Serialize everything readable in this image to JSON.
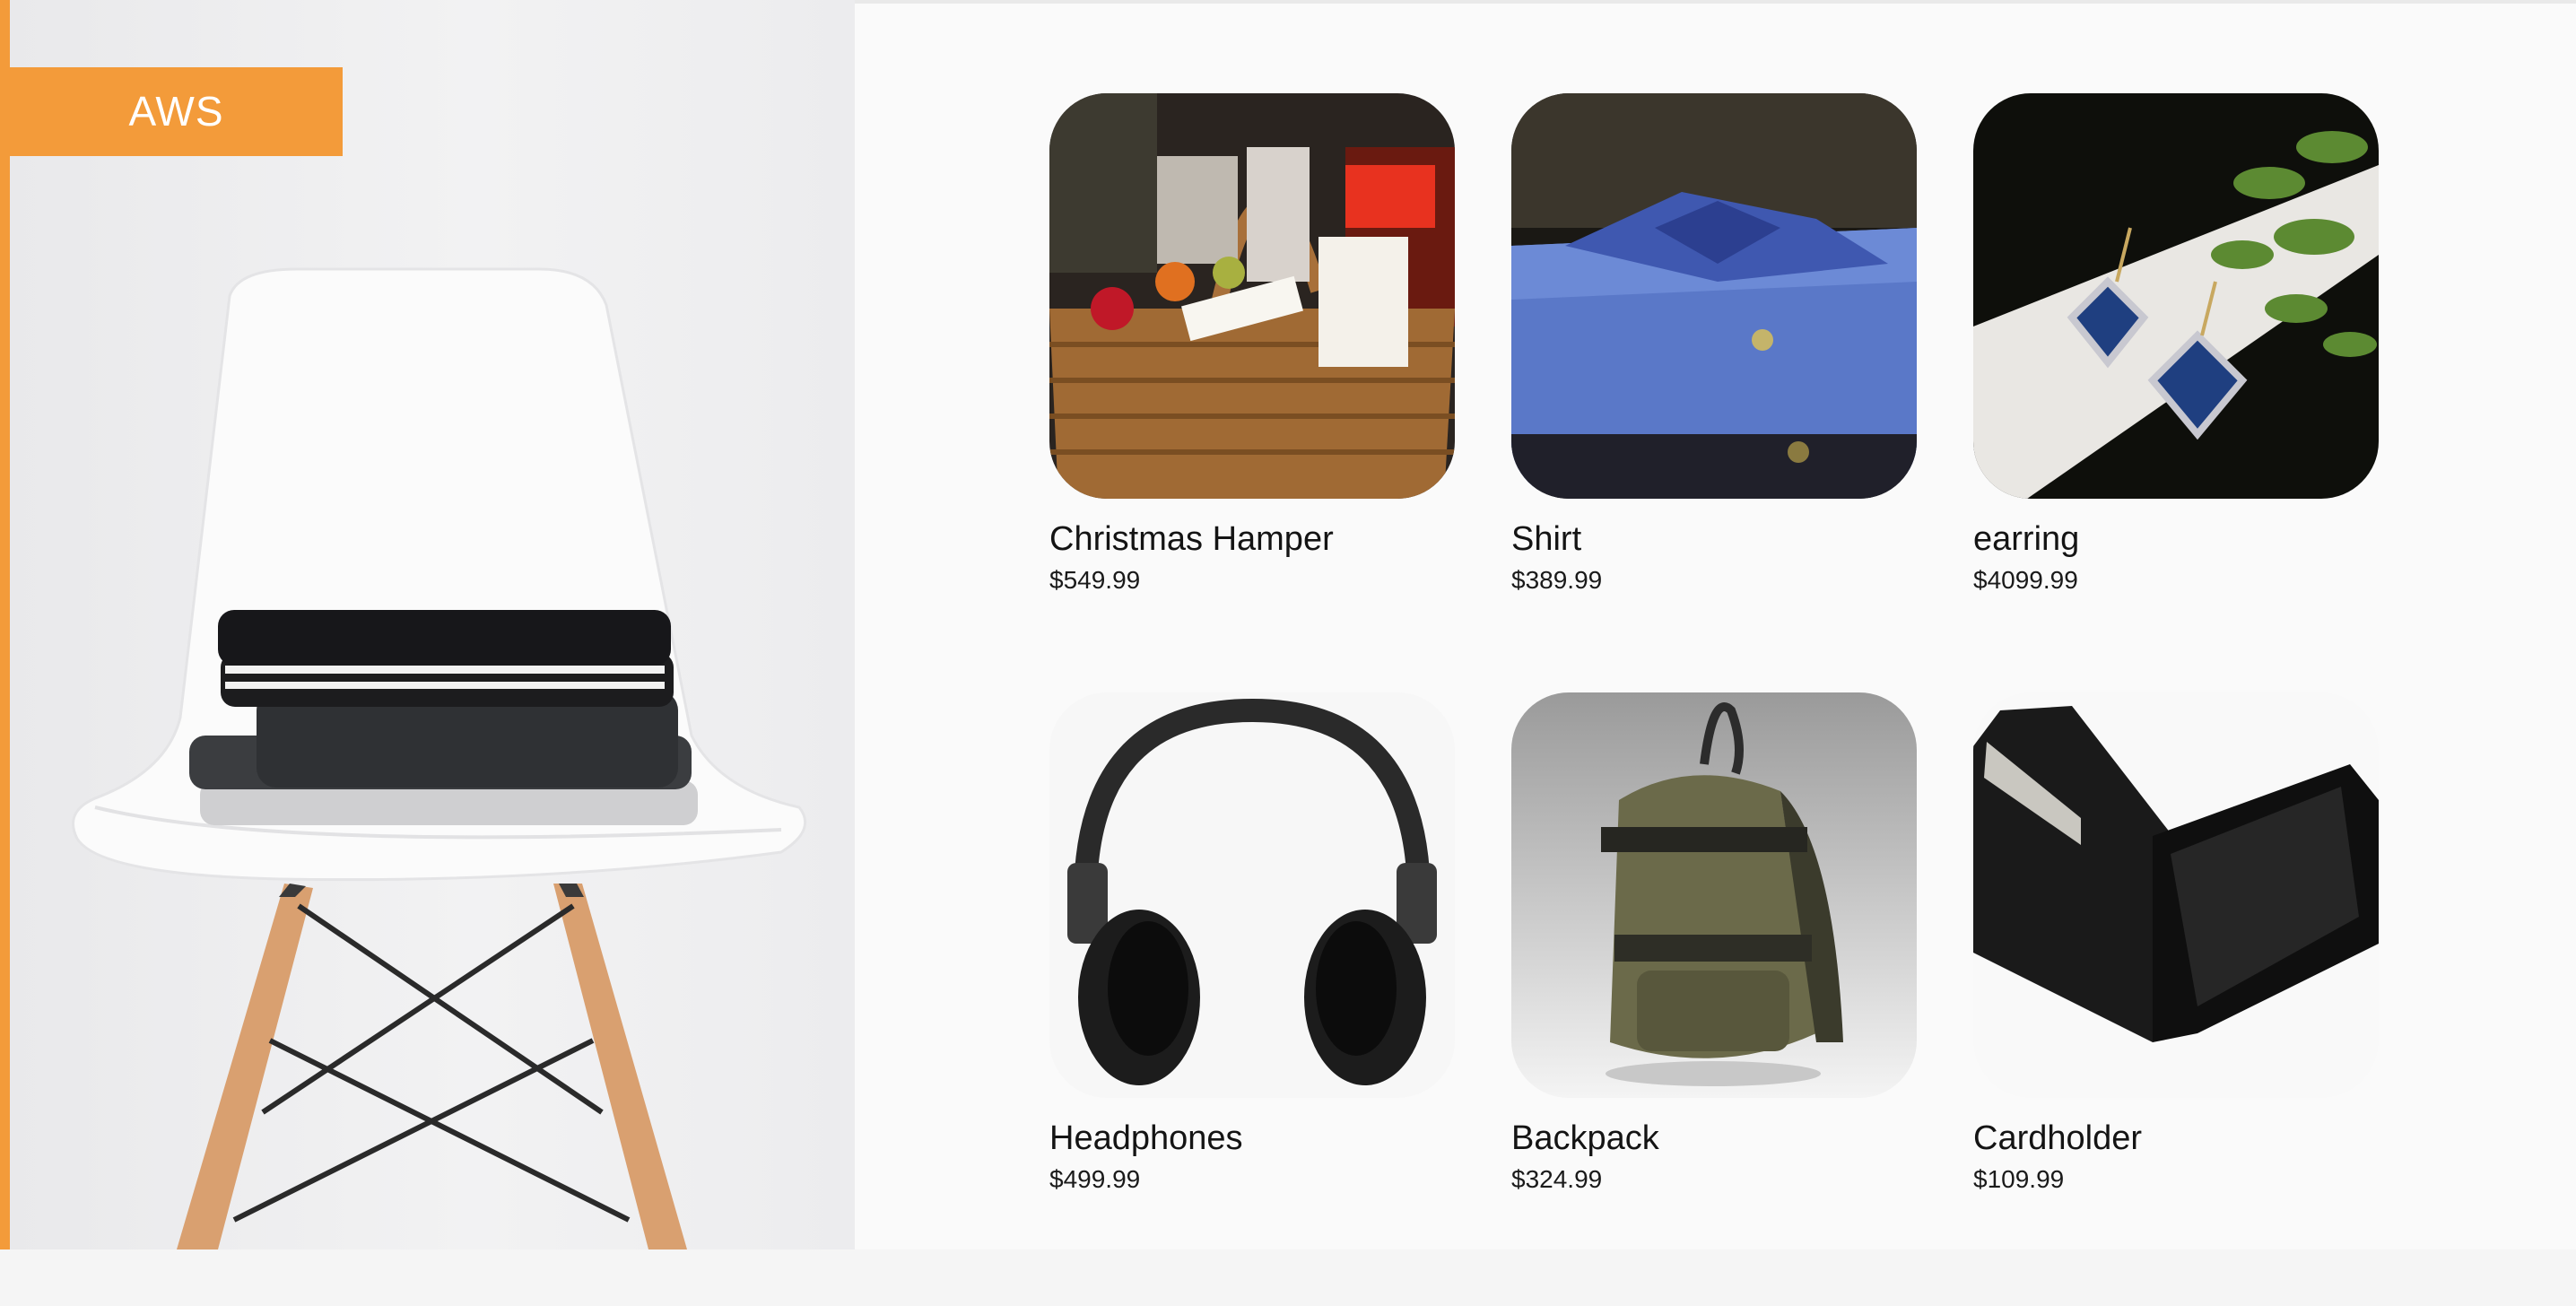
{
  "brand": {
    "label": "AWS"
  },
  "colors": {
    "accent": "#f39b3a",
    "background": "#fafafa"
  },
  "products": [
    {
      "name": "Christmas Hamper",
      "price": "$549.99",
      "image": "gift-basket-image"
    },
    {
      "name": "Shirt",
      "price": "$389.99",
      "image": "blue-shirt-image"
    },
    {
      "name": "earring",
      "price": "$4099.99",
      "image": "earrings-image"
    },
    {
      "name": "Headphones",
      "price": "$499.99",
      "image": "headphones-image"
    },
    {
      "name": "Backpack",
      "price": "$324.99",
      "image": "backpack-image"
    },
    {
      "name": "Cardholder",
      "price": "$109.99",
      "image": "cardholder-image"
    }
  ]
}
